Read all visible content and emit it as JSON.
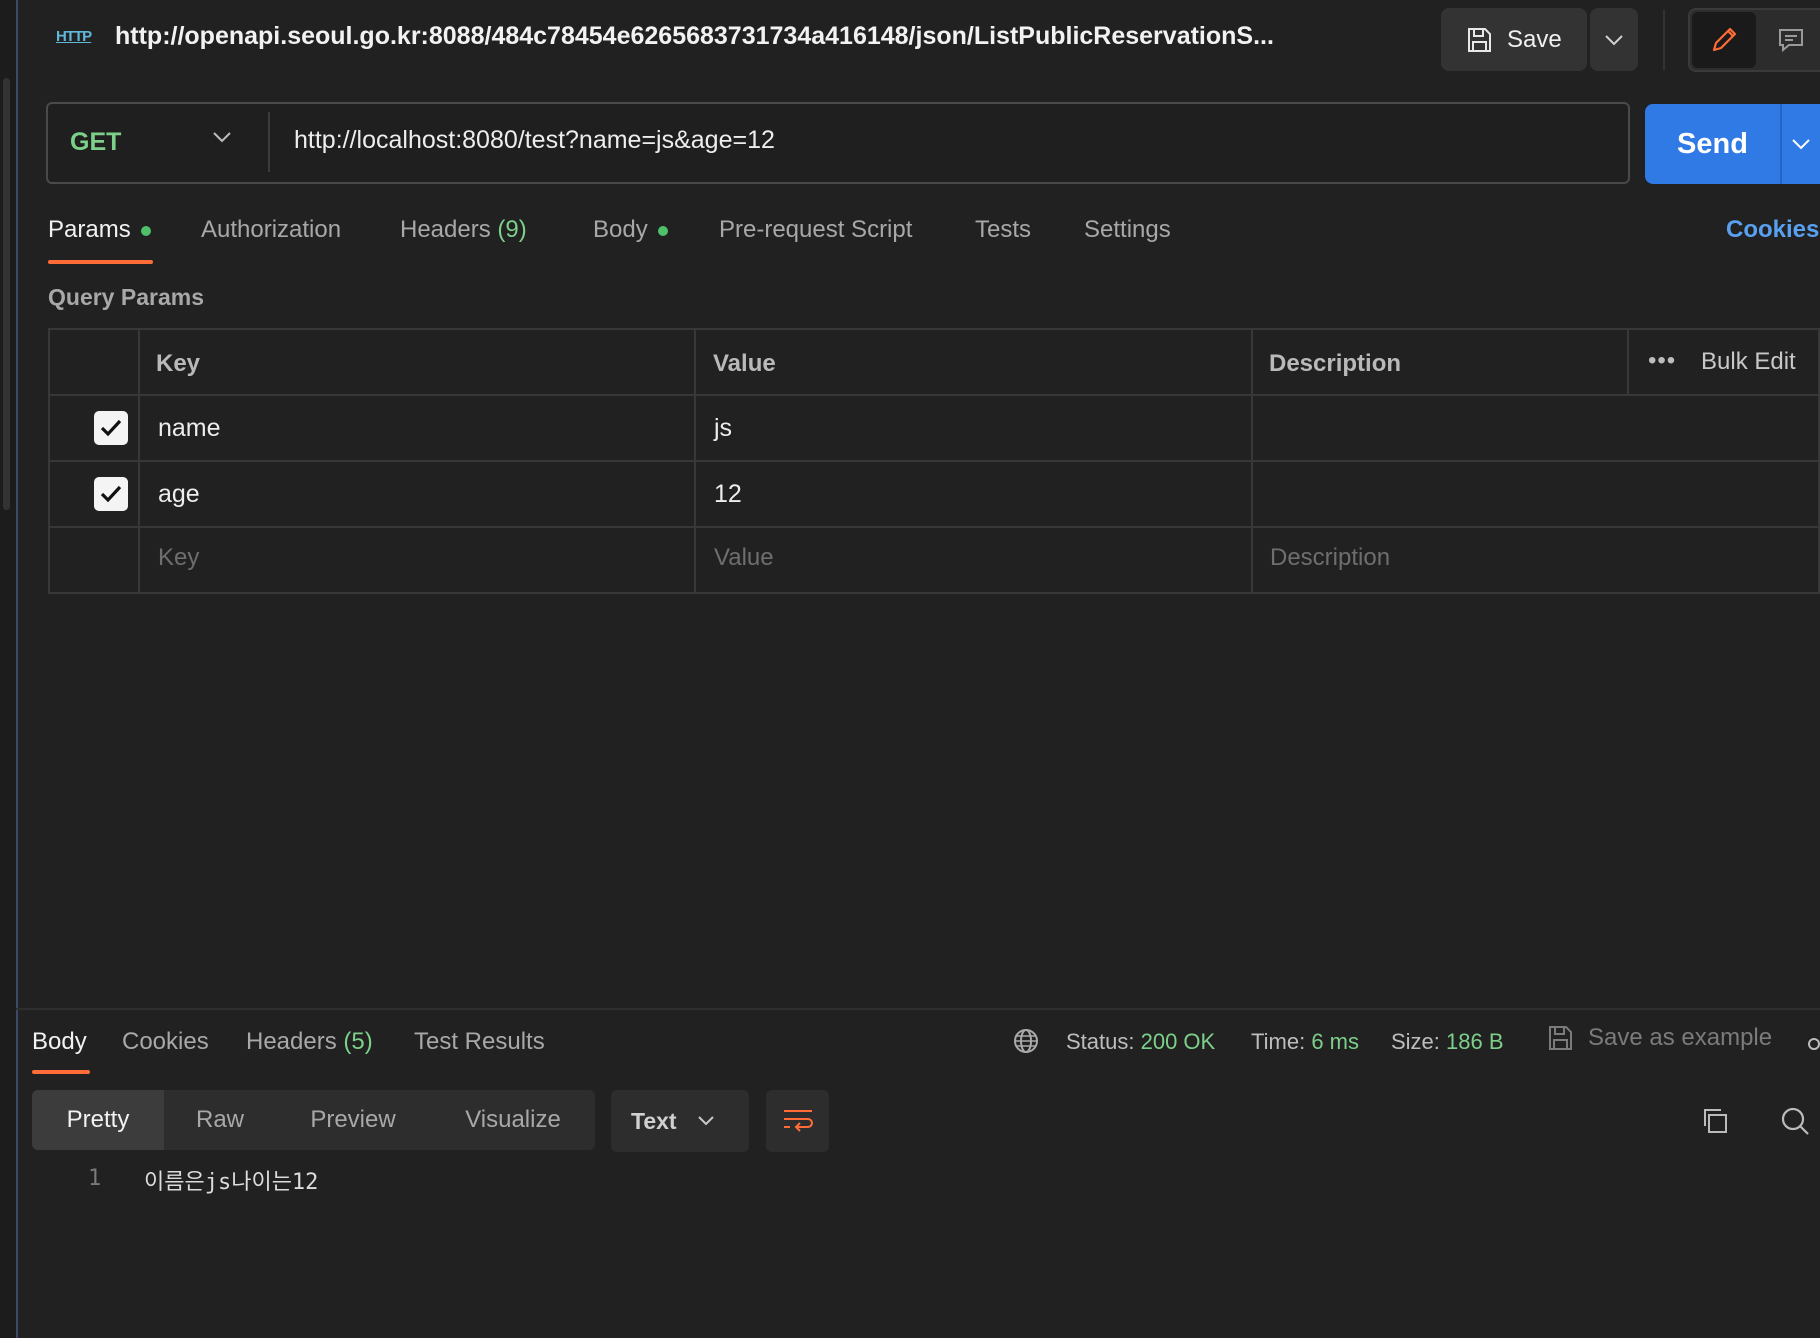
{
  "header": {
    "icon": "http-icon",
    "icon_text": "HTTP",
    "title": "http://openapi.seoul.go.kr:8088/484c78454e6265683731734a416148/json/ListPublicReservationS...",
    "save_label": "Save"
  },
  "request": {
    "method": "GET",
    "url": "http://localhost:8080/test?name=js&age=12",
    "send_label": "Send"
  },
  "request_tabs": [
    {
      "label": "Params",
      "dot": true,
      "active": true
    },
    {
      "label": "Authorization"
    },
    {
      "label": "Headers",
      "count": "(9)"
    },
    {
      "label": "Body",
      "dot": true
    },
    {
      "label": "Pre-request Script"
    },
    {
      "label": "Tests"
    },
    {
      "label": "Settings"
    }
  ],
  "cookies_label": "Cookies",
  "query_params": {
    "title": "Query Params",
    "columns": [
      "Key",
      "Value",
      "Description"
    ],
    "bulk_edit": "Bulk Edit",
    "more_icon": "•••",
    "rows": [
      {
        "checked": true,
        "key": "name",
        "value": "js",
        "description": ""
      },
      {
        "checked": true,
        "key": "age",
        "value": "12",
        "description": ""
      }
    ],
    "placeholders": {
      "key": "Key",
      "value": "Value",
      "description": "Description"
    }
  },
  "response": {
    "tabs": [
      {
        "label": "Body",
        "active": true
      },
      {
        "label": "Cookies"
      },
      {
        "label": "Headers",
        "count": "(5)"
      },
      {
        "label": "Test Results"
      }
    ],
    "status_label": "Status:",
    "status_value": "200 OK",
    "time_label": "Time:",
    "time_value": "6 ms",
    "size_label": "Size:",
    "size_value": "186 B",
    "save_example": "Save as example",
    "views": [
      "Pretty",
      "Raw",
      "Preview",
      "Visualize"
    ],
    "active_view": "Pretty",
    "format": "Text",
    "lines": [
      {
        "no": "1",
        "text": "이름은js나이는12"
      }
    ]
  },
  "colors": {
    "accent": "#ff6c37",
    "send": "#2f7ae5",
    "success": "#7cd08a",
    "link": "#5aa0f0"
  }
}
